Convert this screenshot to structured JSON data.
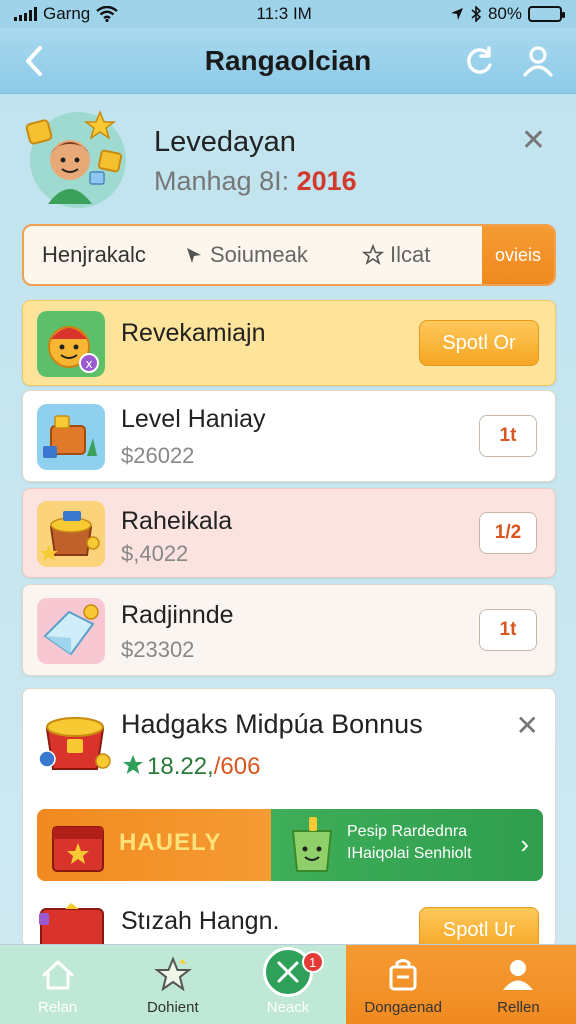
{
  "status_bar": {
    "carrier": "Garng",
    "time": "11:3 IM",
    "battery": "80%",
    "battery_level": 0.8
  },
  "nav": {
    "title": "Rangaolcian"
  },
  "profile": {
    "name": "Levedayan",
    "subtitle_prefix": "Manhag 8I:",
    "year": "2016"
  },
  "tabs": [
    {
      "label": "Henjrakalc"
    },
    {
      "label": "Soiumeak"
    },
    {
      "label": "Ilcat"
    },
    {
      "label": "ovieis"
    }
  ],
  "featured": {
    "title": "Revekamiajn",
    "button": "Spotl Or"
  },
  "list": [
    {
      "title": "Level Haniay",
      "price": "$26022",
      "button": "1t"
    },
    {
      "title": "Raheikala",
      "price": "$,4022",
      "button": "1/2"
    },
    {
      "title": "Radjinnde",
      "price": "$23302",
      "button": "1t"
    }
  ],
  "bonus": {
    "title": "Hadgaks Midpúa Bonnus",
    "value_main": "18.22,",
    "value_tail": "/606",
    "banner_left": "HAUELY",
    "banner_right_line1": "Pesip Rardednra",
    "banner_right_line2": "IHaiqolai Senhiolt",
    "last_title": "Stızah Hangn.",
    "last_button": "Spotl Ur"
  },
  "tabbar": [
    {
      "label": "Relan"
    },
    {
      "label": "Dohient"
    },
    {
      "label": "Neack",
      "badge": "1"
    },
    {
      "label": "Dongaenad"
    },
    {
      "label": "Rellen"
    }
  ],
  "colors": {
    "accent_orange": "#f5a623",
    "nav_blue": "#8ccbe8",
    "banner_green": "#2f9e4d",
    "year_red": "#d33a2e"
  }
}
